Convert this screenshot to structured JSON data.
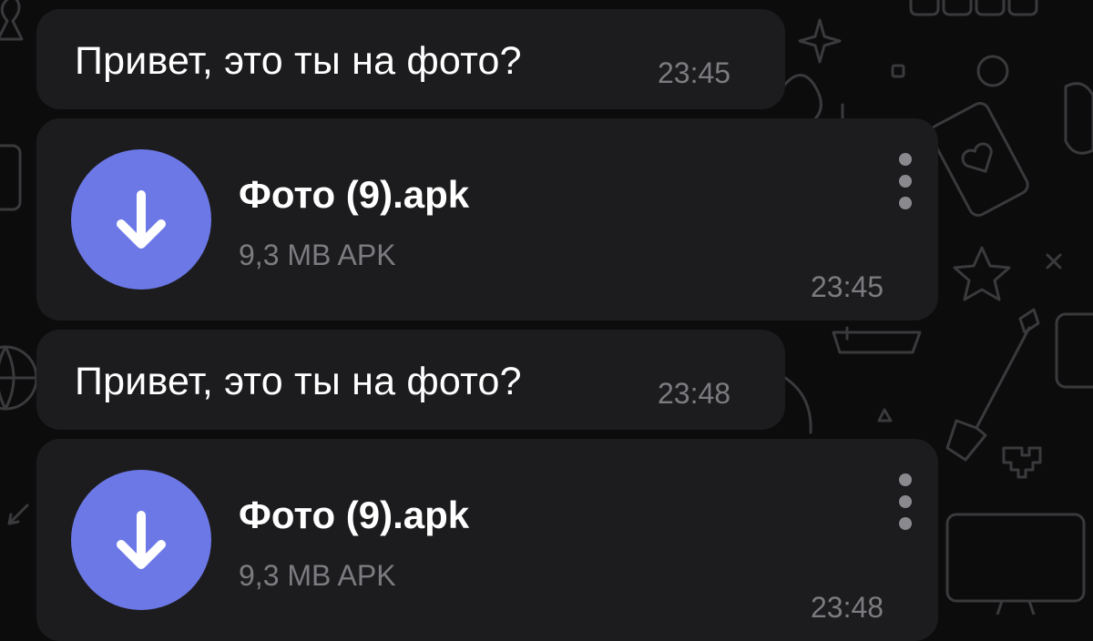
{
  "theme": {
    "background": "#0c0c0d",
    "bubble": "#1c1c1e",
    "accent": "#6c78e6",
    "text": "#ffffff",
    "muted": "#7c7c80"
  },
  "messages": [
    {
      "type": "text",
      "text": "Привет, это ты на фото?",
      "time": "23:45"
    },
    {
      "type": "file",
      "icon": "download-arrow-icon",
      "file_name": "Фото (9).apk",
      "file_meta": "9,3 MB APK",
      "time": "23:45",
      "menu_icon": "more-vertical-icon"
    },
    {
      "type": "text",
      "text": "Привет, это ты на фото?",
      "time": "23:48"
    },
    {
      "type": "file",
      "icon": "download-arrow-icon",
      "file_name": "Фото (9).apk",
      "file_meta": "9,3 MB APK",
      "time": "23:48",
      "menu_icon": "more-vertical-icon"
    }
  ]
}
